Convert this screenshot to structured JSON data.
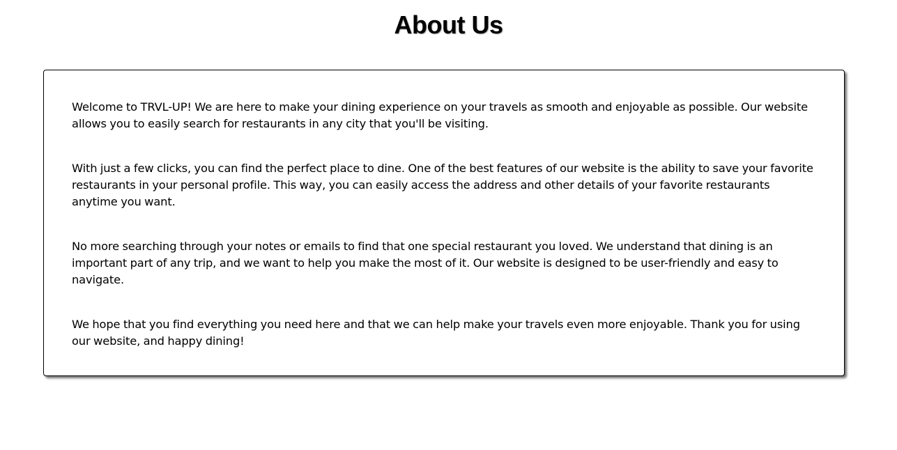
{
  "page": {
    "title": "About Us"
  },
  "about": {
    "paragraphs": [
      "Welcome to TRVL-UP! We are here to make your dining experience on your travels as smooth and enjoyable as possible. Our website allows you to easily search for restaurants in any city that you'll be visiting.",
      "With just a few clicks, you can find the perfect place to dine. One of the best features of our website is the ability to save your favorite restaurants in your personal profile. This way, you can easily access the address and other details of your favorite restaurants anytime you want.",
      "No more searching through your notes or emails to find that one special restaurant you loved. We understand that dining is an important part of any trip, and we want to help you make the most of it. Our website is designed to be user-friendly and easy to navigate.",
      "We hope that you find everything you need here and that we can help make your travels even more enjoyable. Thank you for using our website, and happy dining!"
    ]
  }
}
